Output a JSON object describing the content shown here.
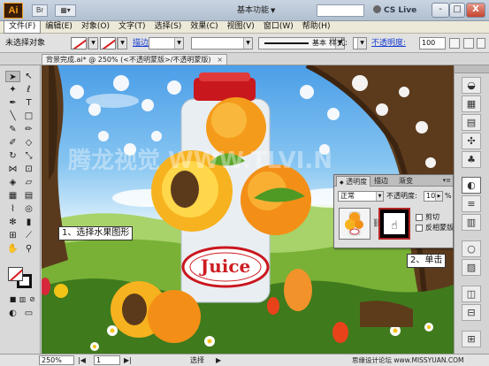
{
  "titlebar": {
    "app_icon": "Ai",
    "bridge_icon": "Br",
    "workspace": "基本功能",
    "cs_live": "CS Live",
    "minimize": "-",
    "maximize": "□",
    "close": "X"
  },
  "menu": [
    "文件(F)",
    "编辑(E)",
    "对象(O)",
    "文字(T)",
    "选择(S)",
    "效果(C)",
    "视图(V)",
    "窗口(W)",
    "帮助(H)"
  ],
  "control_bar": {
    "selection_state": "未选择对象",
    "stroke_label": "描边:",
    "brush_label": "基本",
    "style_label": "样式:",
    "opacity_label": "不透明度:",
    "opacity_value": "100"
  },
  "document_tab": {
    "title": "背景完成.ai* @ 250% (<不透明蒙版>/不透明蒙版)",
    "close": "×"
  },
  "artwork": {
    "juice_label": "Juice",
    "watermark": "腾龙视觉 WWW.TLVI.N"
  },
  "transparency_panel": {
    "tabs": [
      "透明度",
      "描边",
      "渐变"
    ],
    "blend_mode": "正常",
    "opacity_label": "不透明度:",
    "opacity_value": "100",
    "opacity_unit": "%",
    "clip_label": "剪切",
    "invert_label": "反相蒙版"
  },
  "callouts": {
    "step1": "1、选择水果图形",
    "step2": "2、单击"
  },
  "status_bar": {
    "zoom": "250%",
    "artboard": "1",
    "tool_status": "选择",
    "credit": "思缘设计论坛  www.MISSYUAN.COM"
  },
  "colors": {
    "accent_red": "#d81d1d",
    "link_blue": "#1a3fd3",
    "juice_red": "#cc1d22"
  }
}
